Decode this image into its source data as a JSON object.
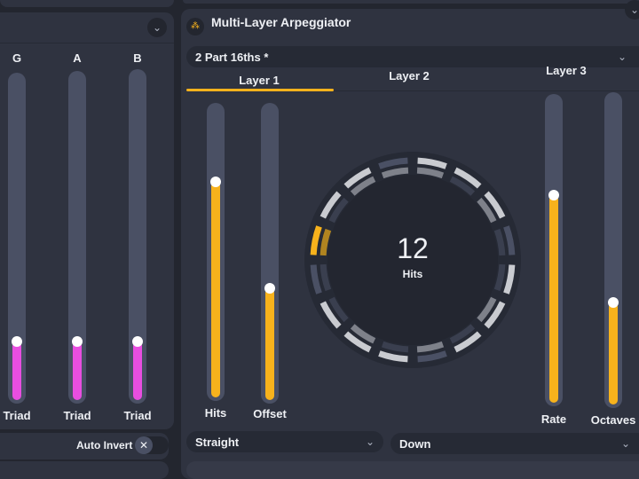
{
  "colors": {
    "accent": "#f7b21c",
    "chord": "#e84ee0",
    "track": "#4a5064",
    "panel": "#2f3340"
  },
  "left_panel": {
    "columns": [
      {
        "header": "G",
        "value": 0.18,
        "label": "Triad"
      },
      {
        "header": "A",
        "value": 0.18,
        "label": "Triad"
      },
      {
        "header": "B",
        "value": 0.18,
        "label": "Triad"
      }
    ],
    "auto_invert": {
      "label": "Auto Invert",
      "icon": "close-icon",
      "glyph": "✕"
    },
    "collapse_icon": "chevron-down-icon"
  },
  "arp": {
    "title": "Multi-Layer Arpeggiator",
    "icon": "arpeggiator-dots-icon",
    "preset": "2 Part 16ths *",
    "tabs": [
      {
        "label": "Layer 1",
        "active": true
      },
      {
        "label": "Layer 2",
        "active": false
      },
      {
        "label": "Layer 3",
        "active": false
      }
    ],
    "sliders": [
      {
        "label": "Hits",
        "value": 0.74
      },
      {
        "label": "Offset",
        "value": 0.38
      },
      {
        "label": "Rate",
        "value": 0.68
      },
      {
        "label": "Octaves",
        "value": 0.33
      }
    ],
    "ring": {
      "value": "12",
      "label": "Hits",
      "steps": 16,
      "current_step": 12,
      "outer": [
        1,
        1,
        1,
        0,
        1,
        1,
        1,
        0,
        1,
        1,
        1,
        0,
        2,
        1,
        1,
        0
      ],
      "inner": [
        1,
        0,
        1,
        0,
        0,
        1,
        0,
        1,
        0,
        1,
        0,
        0,
        3,
        0,
        1,
        1
      ]
    },
    "mode_select": "Straight",
    "direction_select": "Down"
  }
}
